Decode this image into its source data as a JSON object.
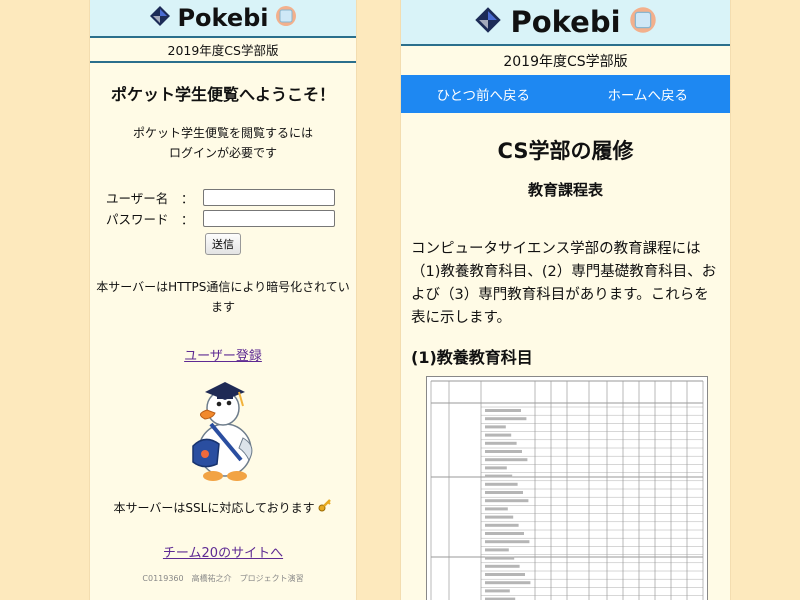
{
  "left": {
    "app_title": "Pokebi",
    "edition": "2019年度CS学部版",
    "welcome": "ポケット学生便覧へようこそ！",
    "login_note_line1": "ポケット学生便覧を閲覧するには",
    "login_note_line2": "ログインが必要です",
    "username_label": "ユーザー名",
    "password_label": "パスワード",
    "colon": "：",
    "username_value": "",
    "password_value": "",
    "submit_label": "送信",
    "https_note": "本サーバーはHTTPS通信により暗号化されています",
    "register_link": "ユーザー登録",
    "ssl_note": "本サーバーはSSLに対応しております",
    "team_link": "チーム20のサイトへ",
    "footer": "C0119360　高橋祐之介　プロジェクト演習"
  },
  "right": {
    "app_title": "Pokebi",
    "edition": "2019年度CS学部版",
    "nav_back": "ひとつ前へ戻る",
    "nav_home": "ホームへ戻る",
    "page_title": "CS学部の履修",
    "page_subtitle": "教育課程表",
    "intro": "コンピュータサイエンス学部の教育課程には（1)教養教育科目、(2）専門基礎教育科目、および（3）専門教育科目があります。これらを表に示します。",
    "section_title": "(1)教養教育科目"
  },
  "colors": {
    "page_bg": "#fde9bd",
    "panel_bg": "#fffbe6",
    "header_bg": "#d9f3f8",
    "nav_bg": "#1e88f2",
    "link": "#5e2a93"
  },
  "icons": [
    "pokeball-logo-icon",
    "notebook-icon",
    "key-icon",
    "mascot-illustration"
  ]
}
